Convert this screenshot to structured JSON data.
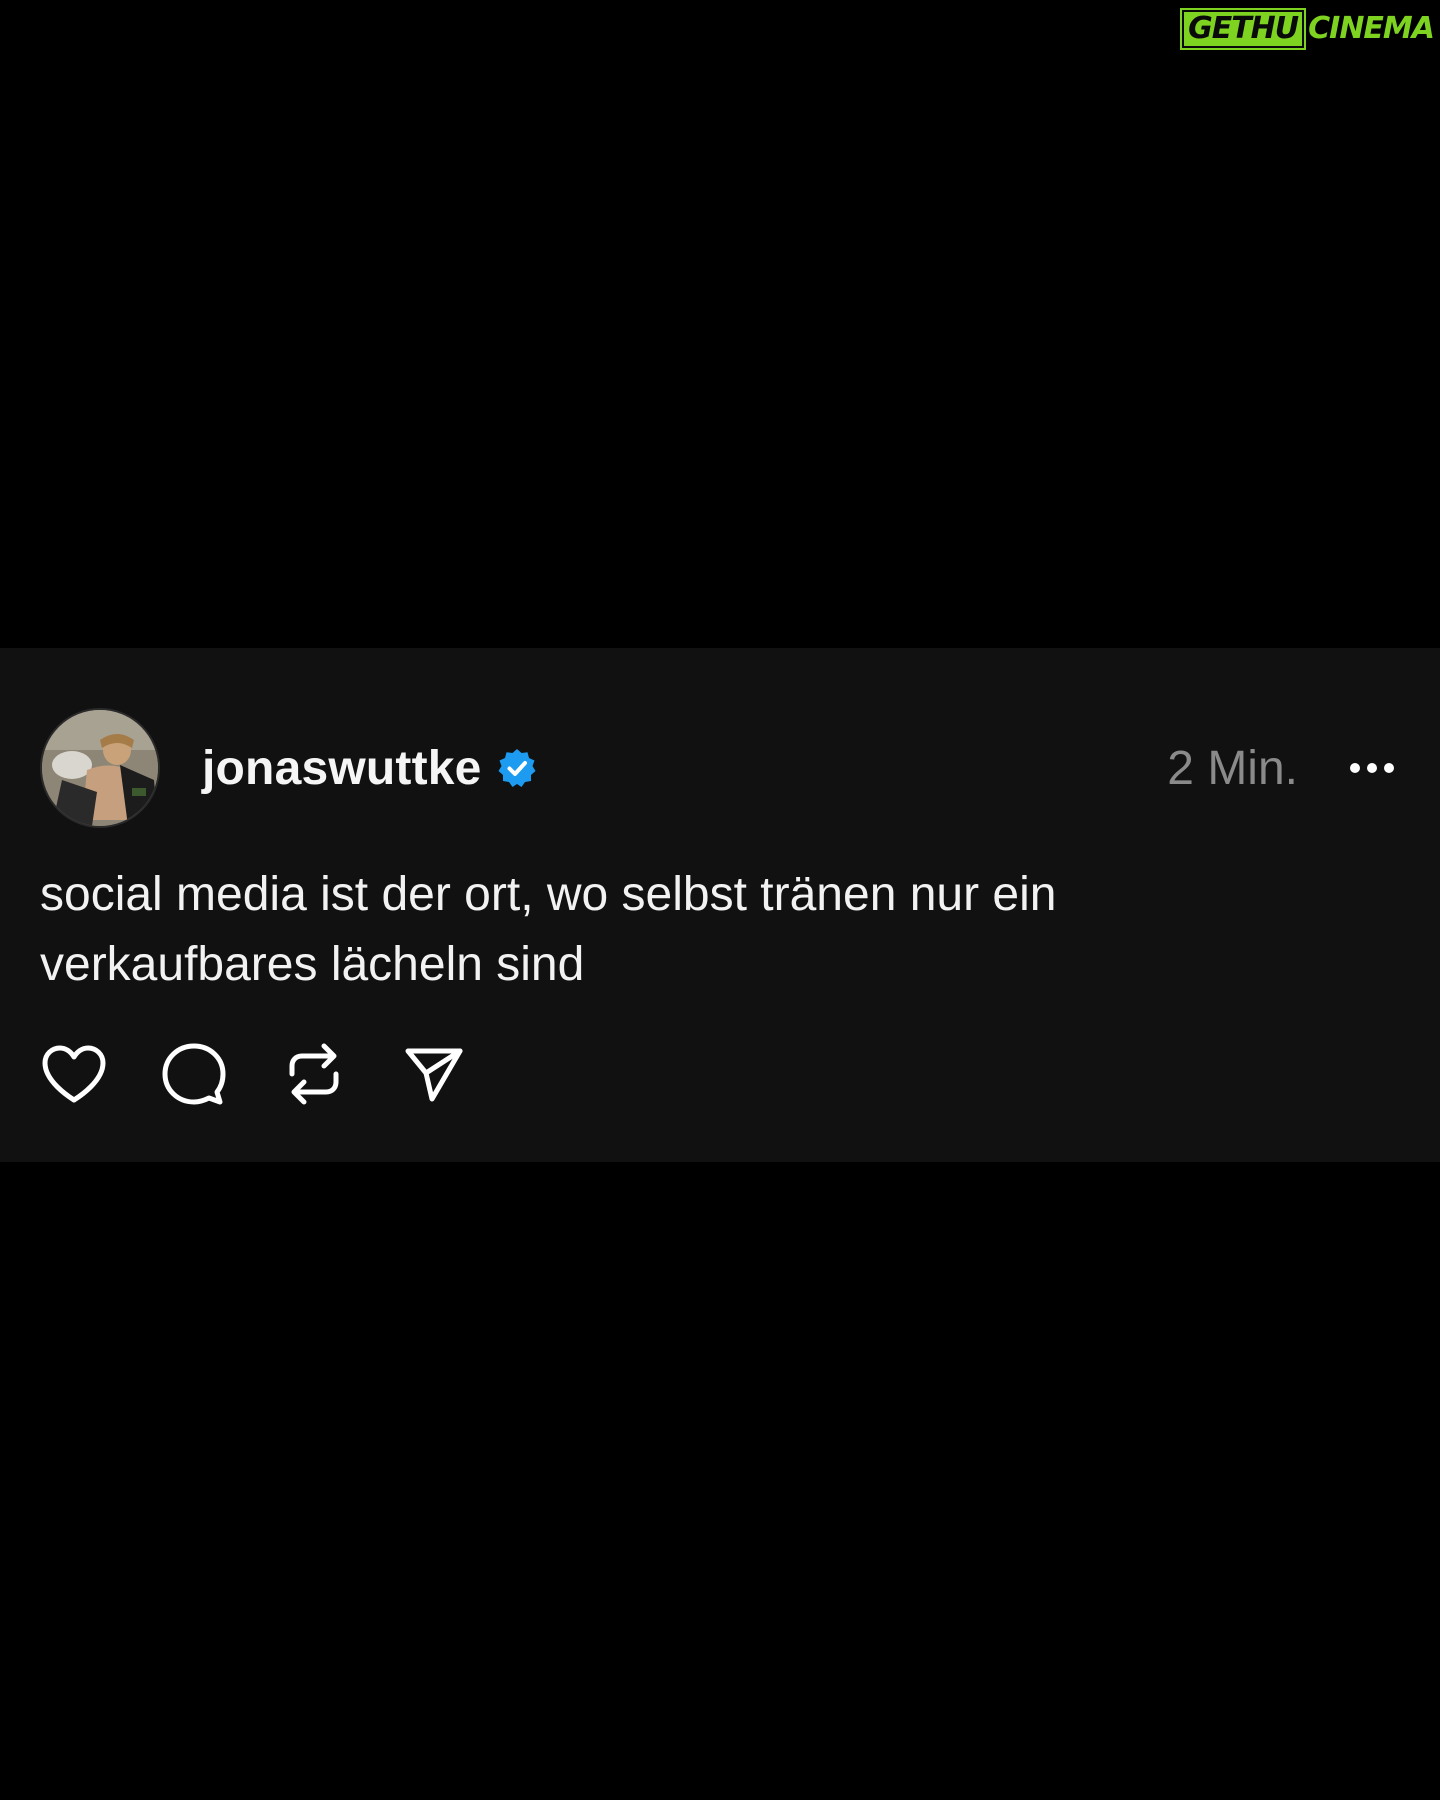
{
  "watermark": {
    "left_text": "GETHU",
    "right_text": "CINEMA",
    "color": "#7ed321"
  },
  "post": {
    "username": "jonaswuttke",
    "verified": true,
    "verified_badge_color": "#1d9bf0",
    "timestamp": "2 Min.",
    "more_icon": "more-horizontal-icon",
    "text": "social media ist der ort, wo selbst tränen nur ein verkaufbares lächeln sind",
    "actions": [
      {
        "name": "like",
        "icon": "heart-icon"
      },
      {
        "name": "reply",
        "icon": "comment-icon"
      },
      {
        "name": "repost",
        "icon": "repost-icon"
      },
      {
        "name": "share",
        "icon": "send-icon"
      }
    ]
  },
  "colors": {
    "background": "#000000",
    "card_background": "#111111",
    "text_primary": "#f2f2f2",
    "text_secondary": "#8a8a8a"
  }
}
